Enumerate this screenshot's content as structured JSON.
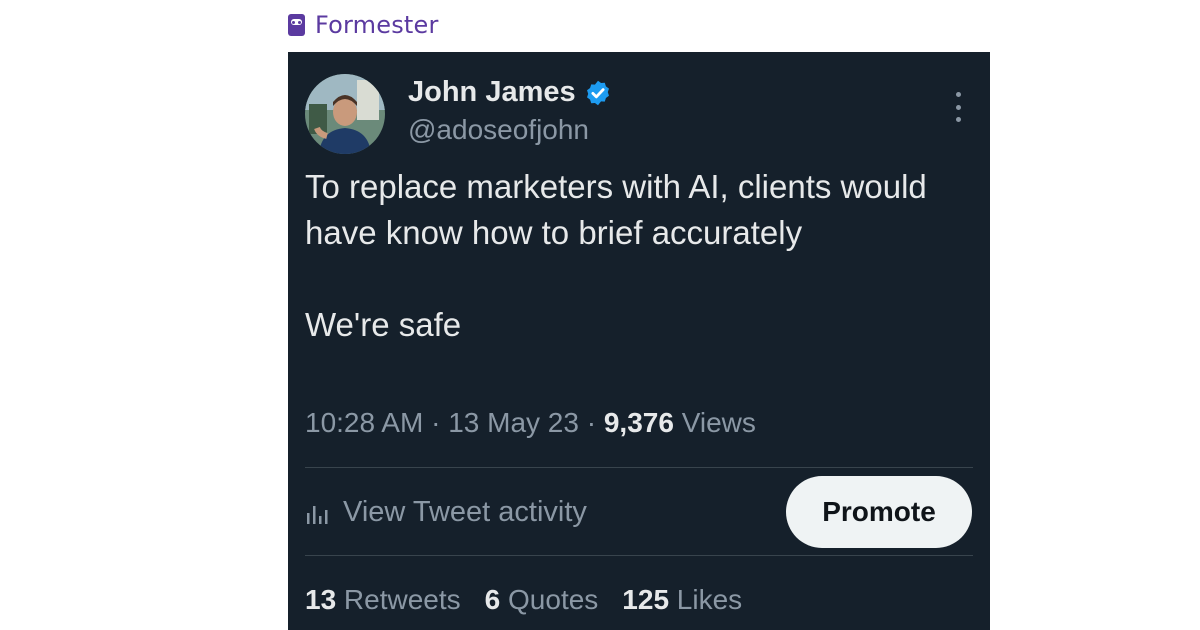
{
  "brand": {
    "name": "Formester",
    "icon": "formester-logo"
  },
  "tweet": {
    "author": {
      "name": "John James",
      "handle": "@adoseofjohn",
      "verified": true,
      "avatar": "profile-photo"
    },
    "text_line1": "To replace marketers with AI, clients would have know how to brief accurately",
    "text_line2": "We're safe",
    "meta": {
      "time": "10:28 AM",
      "sep1": " · ",
      "date": "13 May 23",
      "sep2": " · ",
      "views_count": "9,376",
      "views_label": " Views"
    },
    "activity_label": "View Tweet activity",
    "promote_label": "Promote",
    "stats": {
      "retweets_count": "13",
      "retweets_label": " Retweets",
      "quotes_count": "6",
      "quotes_label": " Quotes",
      "likes_count": "125",
      "likes_label": " Likes"
    }
  },
  "colors": {
    "background": "#15202b",
    "text_primary": "#e7e9ea",
    "text_secondary": "#8b98a5",
    "verified": "#1d9bf0",
    "brand": "#5b3aa0",
    "promote_bg": "#eff3f4"
  }
}
